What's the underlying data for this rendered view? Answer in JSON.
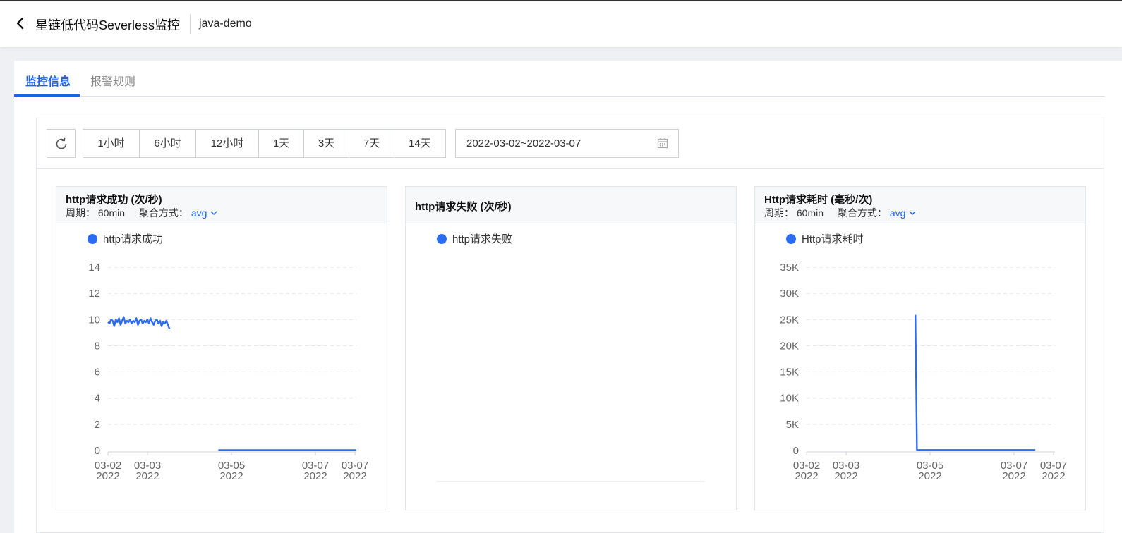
{
  "header": {
    "back_icon": "chevron-left-icon",
    "title": "星链低代码Severless监控",
    "app_name": "java-demo"
  },
  "tabs": [
    {
      "label": "监控信息",
      "active": true
    },
    {
      "label": "报警规则",
      "active": false
    }
  ],
  "toolbar": {
    "refresh_icon": "refresh-icon",
    "ranges": [
      "1小时",
      "6小时",
      "12小时",
      "1天",
      "3天",
      "7天",
      "14天"
    ],
    "date_range": "2022-03-02~2022-03-07",
    "calendar_icon": "calendar-icon"
  },
  "colors": {
    "accent": "#1d62e6",
    "series": "#2b6cf2"
  },
  "cards": [
    {
      "title": "http请求成功 (次/秒)",
      "period_label": "周期：",
      "period_value": "60min",
      "agg_label": "聚合方式：",
      "agg_value": "avg"
    },
    {
      "title": "http请求失败 (次/秒)"
    },
    {
      "title": "Http请求耗时 (毫秒/次)",
      "period_label": "周期：",
      "period_value": "60min",
      "agg_label": "聚合方式：",
      "agg_value": "avg"
    }
  ],
  "chart_data": [
    {
      "type": "line",
      "title": "http请求成功 (次/秒)",
      "legend": [
        "http请求成功"
      ],
      "ylim": [
        0,
        14
      ],
      "yticks": [
        0,
        2,
        4,
        6,
        8,
        10,
        12,
        14
      ],
      "xticks": [
        "03-02 2022",
        "03-03 2022",
        "03-05 2022",
        "03-07 2022",
        "03-07 2022"
      ],
      "grid": true,
      "series": [
        {
          "name": "http请求成功",
          "segments": [
            [
              [
                0.0,
                9.8
              ],
              [
                0.04,
                9.7
              ],
              [
                0.08,
                10.0
              ],
              [
                0.12,
                9.9
              ],
              [
                0.16,
                9.5
              ],
              [
                0.2,
                10.0
              ],
              [
                0.24,
                9.8
              ],
              [
                0.28,
                10.1
              ],
              [
                0.32,
                9.6
              ],
              [
                0.36,
                9.9
              ],
              [
                0.4,
                10.2
              ],
              [
                0.44,
                9.7
              ],
              [
                0.48,
                9.9
              ],
              [
                0.52,
                9.8
              ],
              [
                0.56,
                10.0
              ],
              [
                0.6,
                9.7
              ],
              [
                0.64,
                9.9
              ],
              [
                0.68,
                9.8
              ],
              [
                0.72,
                10.1
              ],
              [
                0.76,
                9.6
              ],
              [
                0.8,
                9.9
              ],
              [
                0.84,
                10.0
              ],
              [
                0.88,
                9.7
              ],
              [
                0.92,
                9.9
              ],
              [
                0.96,
                9.8
              ],
              [
                1.0,
                10.0
              ],
              [
                1.04,
                9.7
              ],
              [
                1.08,
                10.1
              ],
              [
                1.12,
                9.8
              ],
              [
                1.16,
                9.6
              ],
              [
                1.2,
                9.9
              ],
              [
                1.24,
                10.0
              ],
              [
                1.28,
                9.7
              ],
              [
                1.32,
                9.9
              ],
              [
                1.36,
                9.5
              ],
              [
                1.4,
                9.8
              ],
              [
                1.44,
                9.7
              ],
              [
                1.48,
                9.9
              ],
              [
                1.52,
                9.6
              ],
              [
                1.56,
                9.3
              ]
            ],
            [
              [
                2.8,
                0.03
              ],
              [
                6.3,
                0.03
              ]
            ]
          ]
        }
      ]
    },
    {
      "type": "line",
      "title": "http请求失败 (次/秒)",
      "legend": [
        "http请求失败"
      ],
      "series": [
        {
          "name": "http请求失败",
          "segments": []
        }
      ]
    },
    {
      "type": "line",
      "title": "Http请求耗时 (毫秒/次)",
      "legend": [
        "Http请求耗时"
      ],
      "ylim": [
        0,
        35000
      ],
      "yticks": [
        "0",
        "5K",
        "10K",
        "15K",
        "20K",
        "25K",
        "30K",
        "35K"
      ],
      "xticks": [
        "03-02 2022",
        "03-03 2022",
        "03-05 2022",
        "03-07 2022",
        "03-07 2022"
      ],
      "grid": true,
      "series": [
        {
          "name": "Http请求耗时",
          "segments": [
            [
              [
                2.76,
                25900
              ],
              [
                2.8,
                100
              ],
              [
                5.8,
                100
              ]
            ]
          ]
        }
      ]
    }
  ]
}
